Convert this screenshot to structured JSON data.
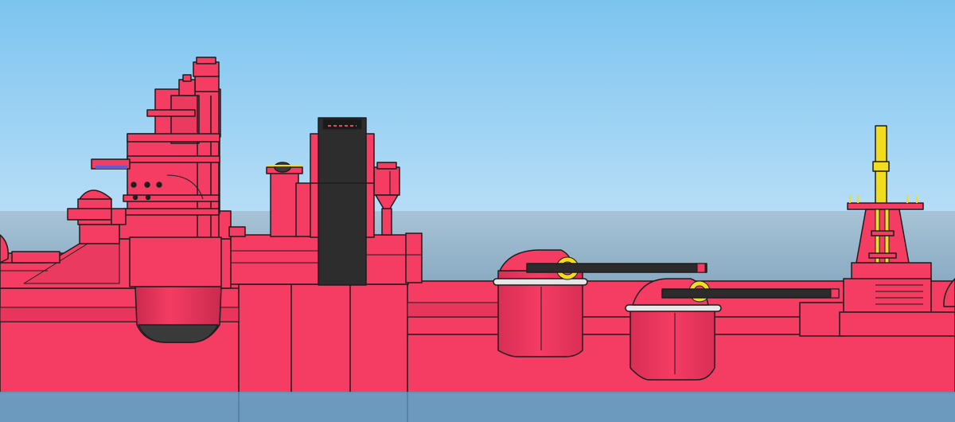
{
  "scene": {
    "subject": "battleship-side-view",
    "colors": {
      "sky_top": "#7cc4f0",
      "sky_bottom": "#b6ddf6",
      "sea_top": "#a7c3d6",
      "sea_bottom": "#4f7b9c",
      "water_band": "#6f9cc1",
      "hull": "#f53c63",
      "hull_shadow": "#d92e55",
      "outline": "#1d1d1d",
      "funnel": "#2d2d2d",
      "gun_barrel": "#2b2b2b",
      "mast": "#f2dc1e",
      "turret_ring": "#e6e6e6"
    },
    "icons": [
      "funnel-icon",
      "main-gun-turret-icon",
      "mast-icon",
      "bridge-tower-icon",
      "searchlight-icon"
    ]
  }
}
